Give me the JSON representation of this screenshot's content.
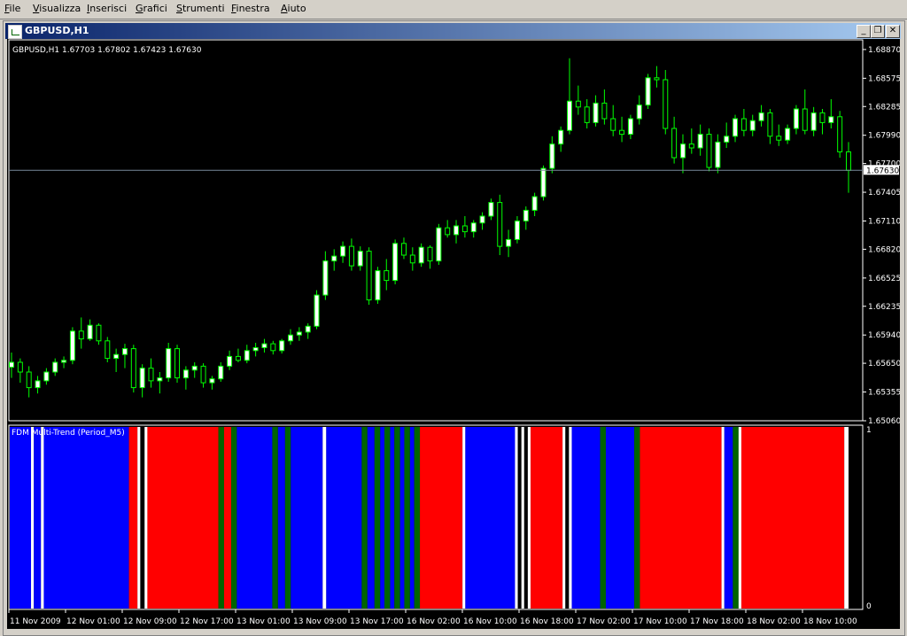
{
  "menu": [
    {
      "label": "File",
      "mnemonic": "F"
    },
    {
      "label": "Visualizza",
      "mnemonic": "V"
    },
    {
      "label": "Inserisci",
      "mnemonic": "I"
    },
    {
      "label": "Grafici",
      "mnemonic": "G"
    },
    {
      "label": "Strumenti",
      "mnemonic": "S"
    },
    {
      "label": "Finestra",
      "mnemonic": "F"
    },
    {
      "label": "Aiuto",
      "mnemonic": "A"
    }
  ],
  "window": {
    "title": "GBPUSD,H1",
    "buttons": {
      "minimize": "_",
      "restore": "❐",
      "close": "✕"
    }
  },
  "chart": {
    "info_line": "GBPUSD,H1  1.67703 1.67802 1.67423 1.67630",
    "current_price_label": "1.67630",
    "price_ticks": [
      "1.68870",
      "1.68575",
      "1.68285",
      "1.67990",
      "1.67700",
      "1.67405",
      "1.67110",
      "1.66820",
      "1.66525",
      "1.66235",
      "1.65940",
      "1.65650",
      "1.65355",
      "1.65060"
    ],
    "time_ticks": [
      "11 Nov 2009",
      "12 Nov 01:00",
      "12 Nov 09:00",
      "12 Nov 17:00",
      "13 Nov 01:00",
      "13 Nov 09:00",
      "13 Nov 17:00",
      "16 Nov 02:00",
      "16 Nov 10:00",
      "16 Nov 18:00",
      "17 Nov 02:00",
      "17 Nov 10:00",
      "17 Nov 18:00",
      "18 Nov 02:00",
      "18 Nov 10:00"
    ],
    "colors": {
      "candle": "#00ff00",
      "bull_body": "#ffffff",
      "bear_body": "#000000",
      "price_line": "#778899",
      "background": "#000000"
    }
  },
  "indicator": {
    "label": "FDM Multi-Trend (Period_M5)",
    "scale_top": "1",
    "scale_bottom": "0",
    "colors": {
      "red": "#ff0000",
      "blue": "#0000ff",
      "green": "#006400",
      "white": "#ffffff"
    }
  },
  "chart_data": {
    "type": "candlestick",
    "symbol": "GBPUSD",
    "timeframe": "H1",
    "ylim": [
      1.6506,
      1.6896
    ],
    "last_price": 1.6763,
    "ohlc": [
      [
        1.6561,
        1.6576,
        1.655,
        1.6566
      ],
      [
        1.6566,
        1.657,
        1.6545,
        1.6556
      ],
      [
        1.6556,
        1.6562,
        1.653,
        1.654
      ],
      [
        1.654,
        1.6552,
        1.6534,
        1.6547
      ],
      [
        1.6547,
        1.656,
        1.6543,
        1.6556
      ],
      [
        1.6556,
        1.657,
        1.6552,
        1.6566
      ],
      [
        1.6566,
        1.6572,
        1.656,
        1.6568
      ],
      [
        1.6568,
        1.6602,
        1.6564,
        1.6598
      ],
      [
        1.6598,
        1.6612,
        1.658,
        1.659
      ],
      [
        1.659,
        1.661,
        1.6588,
        1.6604
      ],
      [
        1.6604,
        1.6606,
        1.6584,
        1.6588
      ],
      [
        1.6588,
        1.6592,
        1.6566,
        1.657
      ],
      [
        1.657,
        1.658,
        1.6556,
        1.6574
      ],
      [
        1.6574,
        1.6585,
        1.656,
        1.658
      ],
      [
        1.658,
        1.6584,
        1.6535,
        1.654
      ],
      [
        1.654,
        1.6564,
        1.653,
        1.656
      ],
      [
        1.656,
        1.657,
        1.654,
        1.6547
      ],
      [
        1.6547,
        1.6556,
        1.6534,
        1.655
      ],
      [
        1.655,
        1.6586,
        1.6546,
        1.658
      ],
      [
        1.658,
        1.6584,
        1.6545,
        1.655
      ],
      [
        1.655,
        1.6562,
        1.6538,
        1.6558
      ],
      [
        1.6558,
        1.6566,
        1.655,
        1.6562
      ],
      [
        1.6562,
        1.6565,
        1.654,
        1.6545
      ],
      [
        1.6545,
        1.6552,
        1.6538,
        1.6549
      ],
      [
        1.6549,
        1.6566,
        1.6546,
        1.6562
      ],
      [
        1.6562,
        1.6578,
        1.6558,
        1.6572
      ],
      [
        1.6572,
        1.658,
        1.6566,
        1.6568
      ],
      [
        1.6568,
        1.6584,
        1.6565,
        1.6578
      ],
      [
        1.6578,
        1.6586,
        1.6572,
        1.6581
      ],
      [
        1.6581,
        1.659,
        1.6576,
        1.6585
      ],
      [
        1.6585,
        1.6588,
        1.6574,
        1.6578
      ],
      [
        1.6578,
        1.659,
        1.6575,
        1.6588
      ],
      [
        1.6588,
        1.66,
        1.6584,
        1.6594
      ],
      [
        1.6594,
        1.6602,
        1.6588,
        1.6597
      ],
      [
        1.6597,
        1.6606,
        1.659,
        1.6603
      ],
      [
        1.6603,
        1.664,
        1.66,
        1.6635
      ],
      [
        1.6635,
        1.668,
        1.663,
        1.667
      ],
      [
        1.667,
        1.6682,
        1.666,
        1.6675
      ],
      [
        1.6675,
        1.669,
        1.6668,
        1.6685
      ],
      [
        1.6685,
        1.6693,
        1.666,
        1.6665
      ],
      [
        1.6665,
        1.6685,
        1.666,
        1.668
      ],
      [
        1.668,
        1.6684,
        1.6625,
        1.663
      ],
      [
        1.663,
        1.6664,
        1.6626,
        1.666
      ],
      [
        1.666,
        1.6672,
        1.664,
        1.665
      ],
      [
        1.665,
        1.6692,
        1.6646,
        1.6688
      ],
      [
        1.6688,
        1.6694,
        1.6672,
        1.6676
      ],
      [
        1.6676,
        1.6684,
        1.666,
        1.6668
      ],
      [
        1.6668,
        1.6688,
        1.6664,
        1.6684
      ],
      [
        1.6684,
        1.6686,
        1.6662,
        1.667
      ],
      [
        1.667,
        1.6708,
        1.6666,
        1.6704
      ],
      [
        1.6704,
        1.6712,
        1.6694,
        1.6697
      ],
      [
        1.6697,
        1.6712,
        1.6688,
        1.6706
      ],
      [
        1.6706,
        1.6716,
        1.6694,
        1.67
      ],
      [
        1.67,
        1.6712,
        1.6694,
        1.6709
      ],
      [
        1.6709,
        1.672,
        1.6702,
        1.6716
      ],
      [
        1.6716,
        1.6734,
        1.6712,
        1.673
      ],
      [
        1.673,
        1.6738,
        1.6676,
        1.6685
      ],
      [
        1.6685,
        1.6702,
        1.6674,
        1.6692
      ],
      [
        1.6692,
        1.6716,
        1.6688,
        1.6711
      ],
      [
        1.6711,
        1.6726,
        1.6702,
        1.6722
      ],
      [
        1.6722,
        1.674,
        1.6716,
        1.6736
      ],
      [
        1.6736,
        1.6768,
        1.6732,
        1.6765
      ],
      [
        1.6765,
        1.6798,
        1.676,
        1.679
      ],
      [
        1.679,
        1.6808,
        1.6782,
        1.6804
      ],
      [
        1.6804,
        1.6878,
        1.68,
        1.6834
      ],
      [
        1.6834,
        1.685,
        1.682,
        1.6828
      ],
      [
        1.6828,
        1.6836,
        1.6806,
        1.6812
      ],
      [
        1.6812,
        1.684,
        1.6808,
        1.6832
      ],
      [
        1.6832,
        1.6846,
        1.681,
        1.6816
      ],
      [
        1.6816,
        1.683,
        1.6798,
        1.6804
      ],
      [
        1.6804,
        1.6818,
        1.6792,
        1.68
      ],
      [
        1.68,
        1.682,
        1.6795,
        1.6816
      ],
      [
        1.6816,
        1.684,
        1.681,
        1.683
      ],
      [
        1.683,
        1.6862,
        1.6826,
        1.6858
      ],
      [
        1.6858,
        1.687,
        1.6848,
        1.6856
      ],
      [
        1.6856,
        1.6866,
        1.68,
        1.6806
      ],
      [
        1.6806,
        1.6818,
        1.677,
        1.6776
      ],
      [
        1.6776,
        1.68,
        1.676,
        1.679
      ],
      [
        1.679,
        1.6806,
        1.678,
        1.6786
      ],
      [
        1.6786,
        1.681,
        1.6778,
        1.68
      ],
      [
        1.68,
        1.6806,
        1.6762,
        1.6766
      ],
      [
        1.6766,
        1.68,
        1.676,
        1.6792
      ],
      [
        1.6792,
        1.6812,
        1.6786,
        1.6798
      ],
      [
        1.6798,
        1.682,
        1.6792,
        1.6816
      ],
      [
        1.6816,
        1.6826,
        1.6798,
        1.6804
      ],
      [
        1.6804,
        1.682,
        1.6798,
        1.6814
      ],
      [
        1.6814,
        1.683,
        1.6808,
        1.6822
      ],
      [
        1.6822,
        1.6826,
        1.679,
        1.6798
      ],
      [
        1.6798,
        1.681,
        1.6788,
        1.6794
      ],
      [
        1.6794,
        1.681,
        1.679,
        1.6806
      ],
      [
        1.6806,
        1.683,
        1.68,
        1.6826
      ],
      [
        1.6826,
        1.6846,
        1.68,
        1.6804
      ],
      [
        1.6804,
        1.6828,
        1.6798,
        1.6822
      ],
      [
        1.6822,
        1.6826,
        1.68,
        1.6812
      ],
      [
        1.6812,
        1.6836,
        1.6806,
        1.6818
      ],
      [
        1.6818,
        1.6824,
        1.6776,
        1.6782
      ],
      [
        1.6782,
        1.6792,
        1.674,
        1.6763
      ]
    ],
    "indicator_segments": [
      {
        "color": "blue",
        "weight": 3
      },
      {
        "color": "white",
        "weight": 0.4
      },
      {
        "color": "blue",
        "weight": 1
      },
      {
        "color": "white",
        "weight": 0.4
      },
      {
        "color": "blue",
        "weight": 12
      },
      {
        "color": "red",
        "weight": 1.2
      },
      {
        "color": "white",
        "weight": 0.4
      },
      {
        "color": "black",
        "weight": 0.6
      },
      {
        "color": "white",
        "weight": 0.4
      },
      {
        "color": "red",
        "weight": 10
      },
      {
        "color": "green",
        "weight": 0.8
      },
      {
        "color": "red",
        "weight": 1
      },
      {
        "color": "green",
        "weight": 0.8
      },
      {
        "color": "blue",
        "weight": 5
      },
      {
        "color": "green",
        "weight": 0.8
      },
      {
        "color": "blue",
        "weight": 1
      },
      {
        "color": "green",
        "weight": 0.8
      },
      {
        "color": "blue",
        "weight": 4.5
      },
      {
        "color": "white",
        "weight": 0.5
      },
      {
        "color": "blue",
        "weight": 5
      },
      {
        "color": "green",
        "weight": 0.8
      },
      {
        "color": "blue",
        "weight": 1
      },
      {
        "color": "green",
        "weight": 0.8
      },
      {
        "color": "blue",
        "weight": 0.6
      },
      {
        "color": "green",
        "weight": 0.8
      },
      {
        "color": "blue",
        "weight": 0.6
      },
      {
        "color": "green",
        "weight": 0.8
      },
      {
        "color": "blue",
        "weight": 0.6
      },
      {
        "color": "green",
        "weight": 0.8
      },
      {
        "color": "blue",
        "weight": 0.6
      },
      {
        "color": "green",
        "weight": 0.8
      },
      {
        "color": "red",
        "weight": 6
      },
      {
        "color": "white",
        "weight": 0.4
      },
      {
        "color": "blue",
        "weight": 7
      },
      {
        "color": "white",
        "weight": 0.4
      },
      {
        "color": "black",
        "weight": 0.5
      },
      {
        "color": "white",
        "weight": 0.4
      },
      {
        "color": "black",
        "weight": 0.5
      },
      {
        "color": "white",
        "weight": 0.4
      },
      {
        "color": "red",
        "weight": 4.5
      },
      {
        "color": "white",
        "weight": 0.4
      },
      {
        "color": "black",
        "weight": 0.5
      },
      {
        "color": "white",
        "weight": 0.4
      },
      {
        "color": "blue",
        "weight": 4
      },
      {
        "color": "green",
        "weight": 0.8
      },
      {
        "color": "blue",
        "weight": 4
      },
      {
        "color": "green",
        "weight": 0.8
      },
      {
        "color": "red",
        "weight": 11.5
      },
      {
        "color": "white",
        "weight": 0.4
      },
      {
        "color": "blue",
        "weight": 1.2
      },
      {
        "color": "green",
        "weight": 0.8
      },
      {
        "color": "white",
        "weight": 0.4
      },
      {
        "color": "red",
        "weight": 14.5
      },
      {
        "color": "white",
        "weight": 0.6
      }
    ]
  }
}
